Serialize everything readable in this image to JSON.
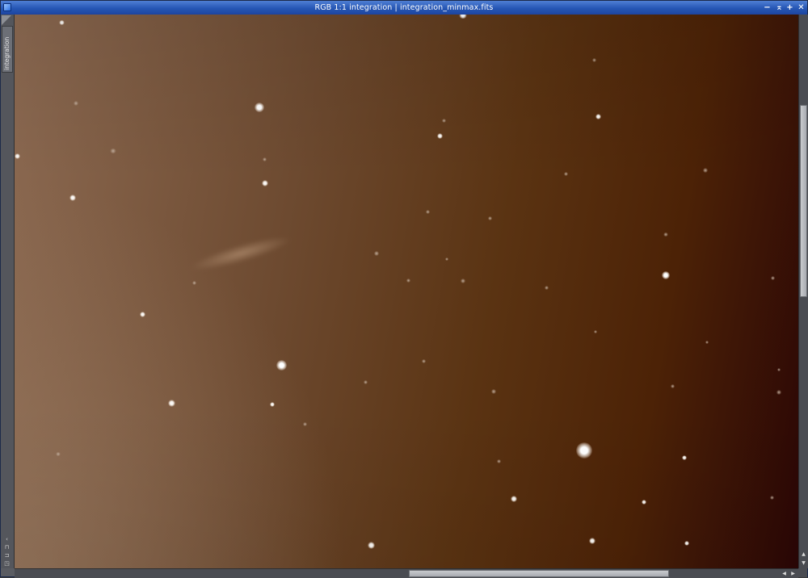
{
  "window": {
    "title": "RGB 1:1 integration | integration_minmax.fits",
    "controls": {
      "minimize": "−",
      "shade": "⌅",
      "maximize": "+",
      "close": "✕"
    }
  },
  "left_panel": {
    "view_tab_label": "integration",
    "bottom_icons": [
      "‹",
      "⊓",
      "⊐",
      "◳"
    ]
  },
  "scrollbars": {
    "vertical": {
      "position": 0.16,
      "visible_fraction": 0.35
    },
    "horizontal": {
      "position": 0.5,
      "visible_fraction": 0.33
    },
    "arrows": {
      "up": "▲",
      "down": "▼",
      "left": "◀",
      "right": "▶"
    }
  },
  "image": {
    "description_colors": {
      "left": "#8c6a52",
      "center": "#5a3312",
      "right": "#2a0505"
    }
  }
}
